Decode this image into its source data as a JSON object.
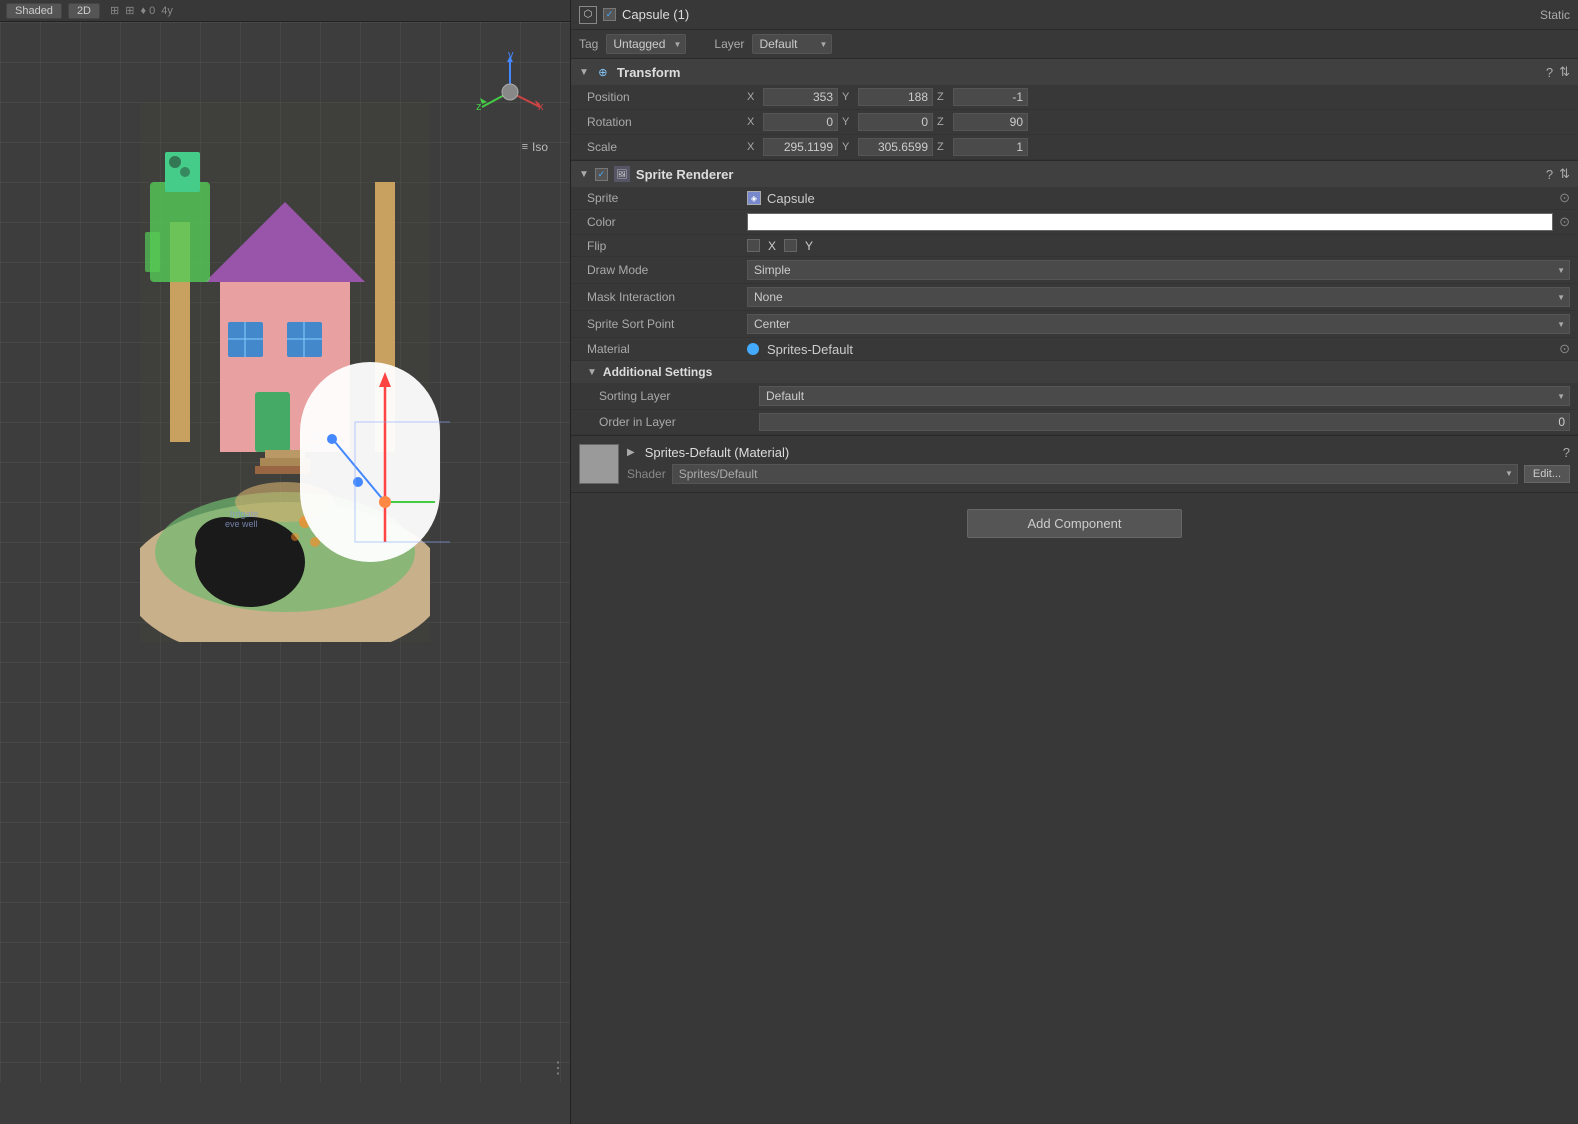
{
  "toolbar": {
    "shading": "Shaded",
    "dim": "2D",
    "iso_label": "Iso"
  },
  "inspector": {
    "object_name": "Capsule (1)",
    "static_label": "Static",
    "tag_label": "Tag",
    "tag_value": "Untagged",
    "layer_label": "Layer",
    "layer_value": "Default",
    "transform": {
      "title": "Transform",
      "position_label": "Position",
      "pos_x": "353",
      "pos_y": "188",
      "pos_z": "-1",
      "rotation_label": "Rotation",
      "rot_x": "0",
      "rot_y": "0",
      "rot_z": "90",
      "scale_label": "Scale",
      "scale_x": "295.1199",
      "scale_y": "305.6599",
      "scale_z": "1"
    },
    "sprite_renderer": {
      "title": "Sprite Renderer",
      "sprite_label": "Sprite",
      "sprite_value": "Capsule",
      "color_label": "Color",
      "flip_label": "Flip",
      "flip_x": "X",
      "flip_y": "Y",
      "draw_mode_label": "Draw Mode",
      "draw_mode_value": "Simple",
      "mask_interaction_label": "Mask Interaction",
      "mask_interaction_value": "None",
      "sprite_sort_point_label": "Sprite Sort Point",
      "sprite_sort_point_value": "Center",
      "material_label": "Material",
      "material_value": "Sprites-Default",
      "additional_settings_title": "Additional Settings",
      "sorting_layer_label": "Sorting Layer",
      "sorting_layer_value": "Default",
      "order_in_layer_label": "Order in Layer",
      "order_in_layer_value": "0"
    },
    "material": {
      "name": "Sprites-Default (Material)",
      "shader_label": "Shader",
      "shader_value": "Sprites/Default",
      "edit_btn": "Edit..."
    },
    "add_component_btn": "Add Component"
  }
}
